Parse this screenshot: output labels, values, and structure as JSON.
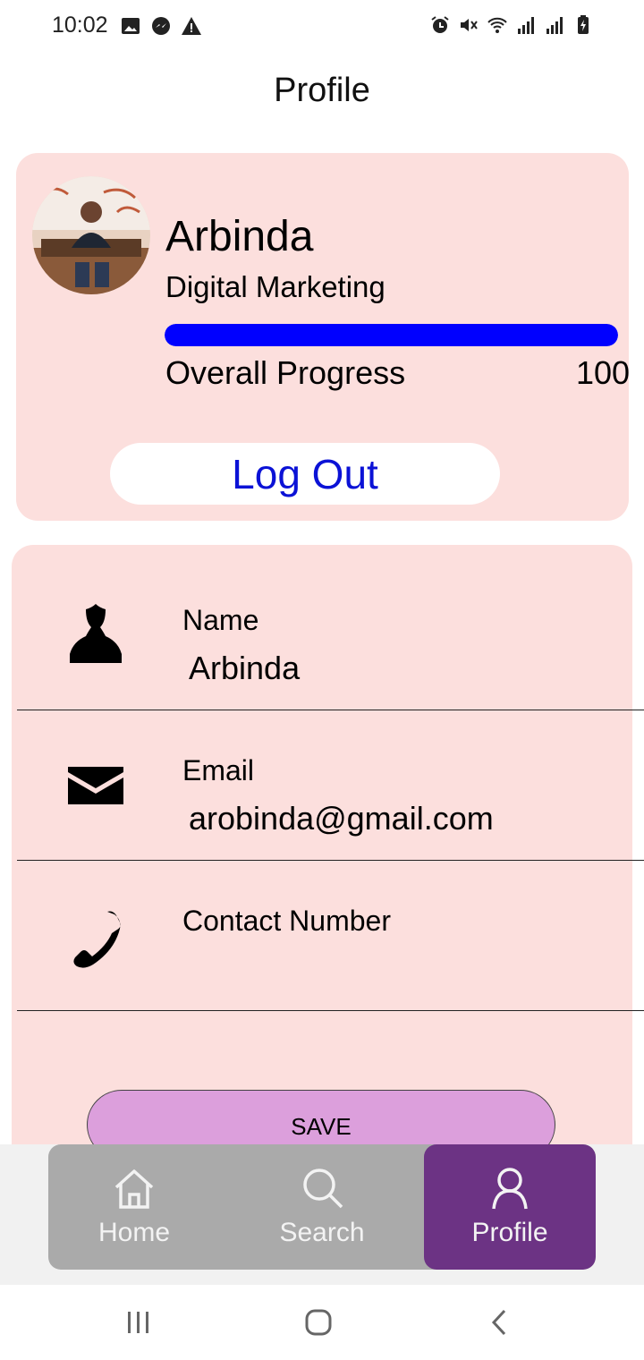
{
  "status_bar": {
    "time": "10:02",
    "left_icons": [
      "image-icon",
      "messenger-icon",
      "warning-icon"
    ],
    "right_icons": [
      "alarm-icon",
      "mute-icon",
      "wifi-icon",
      "signal-icon",
      "signal-icon",
      "battery-charging-icon"
    ]
  },
  "header": {
    "title": "Profile"
  },
  "profile": {
    "name": "Arbinda",
    "role": "Digital Marketing",
    "progress_label": "Overall Progress",
    "progress_value": 1.0,
    "progress_text": "100%",
    "logout_label": "Log Out"
  },
  "details": {
    "fields": [
      {
        "icon": "person-icon",
        "label": "Name",
        "value": "Arbinda"
      },
      {
        "icon": "mail-icon",
        "label": "Email",
        "value": "arobinda@gmail.com"
      },
      {
        "icon": "phone-icon",
        "label": "Contact Number",
        "value": ""
      }
    ],
    "save_label": "SAVE"
  },
  "bottom_nav": {
    "items": [
      {
        "icon": "home-icon",
        "label": "Home",
        "active": false
      },
      {
        "icon": "search-icon",
        "label": "Search",
        "active": false
      },
      {
        "icon": "profile-icon",
        "label": "Profile",
        "active": true
      }
    ],
    "bar_color": "#aaaaaa",
    "active_color": "#6c3384"
  },
  "colors": {
    "card_background": "#fcdfdd",
    "progress_fill": "#0000ff",
    "logout_text": "#0b12d6",
    "save_background": "#dc9fdc"
  },
  "system_nav": [
    "recents-icon",
    "home-circle-icon",
    "back-icon"
  ]
}
